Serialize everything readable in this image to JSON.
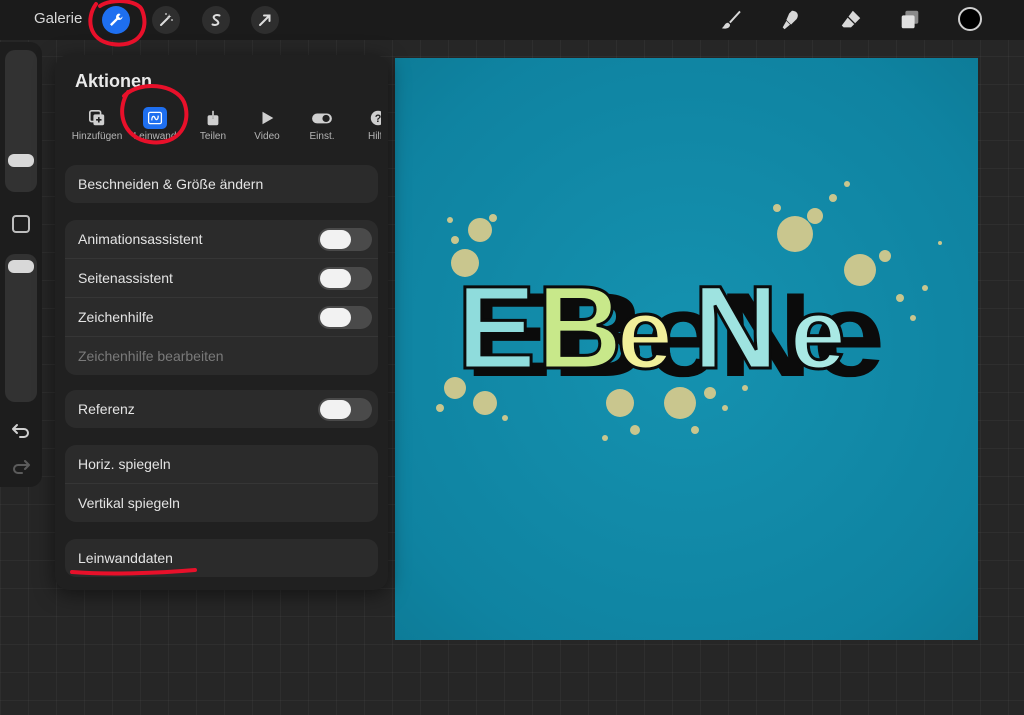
{
  "topbar": {
    "gallery_label": "Galerie",
    "left_tools": [
      "wrench-icon",
      "magic-wand-icon",
      "selection-icon",
      "transform-arrow-icon"
    ],
    "right_tools": [
      "brush-icon",
      "smudge-icon",
      "eraser-icon",
      "layers-icon"
    ],
    "color": "#000000",
    "accent": "#1e6ff0"
  },
  "sidebar": {
    "brush_size_level": 0.75,
    "opacity_level": 0.05
  },
  "actions": {
    "title": "Aktionen",
    "tabs": [
      {
        "label": "Hinzufügen",
        "icon": "add-image-icon"
      },
      {
        "label": "Leinwand",
        "icon": "canvas-icon",
        "selected": true
      },
      {
        "label": "Teilen",
        "icon": "share-icon"
      },
      {
        "label": "Video",
        "icon": "play-icon"
      },
      {
        "label": "Einst.",
        "icon": "toggle-icon"
      },
      {
        "label": "Hilfe",
        "icon": "help-icon"
      }
    ],
    "crop_resize": "Beschneiden & Größe ändern",
    "animation_assist": "Animationsassistent",
    "page_assist": "Seitenassistent",
    "drawing_guide": "Zeichenhilfe",
    "edit_drawing_guide": "Zeichenhilfe bearbeiten",
    "reference": "Referenz",
    "flip_horizontal": "Horiz. spiegeln",
    "flip_vertical": "Vertikal spiegeln",
    "canvas_info": "Leinwanddaten"
  },
  "canvas": {
    "artwork_text": "EBeNe",
    "background": "#1290ae",
    "letter_colors": [
      "#8fdcdc",
      "#c8e88a",
      "#f1ef9a",
      "#9ee3e0",
      "#a9e9e4"
    ],
    "splash_color": "#c9c68e"
  },
  "annotations": {
    "color": "#e8102a"
  }
}
